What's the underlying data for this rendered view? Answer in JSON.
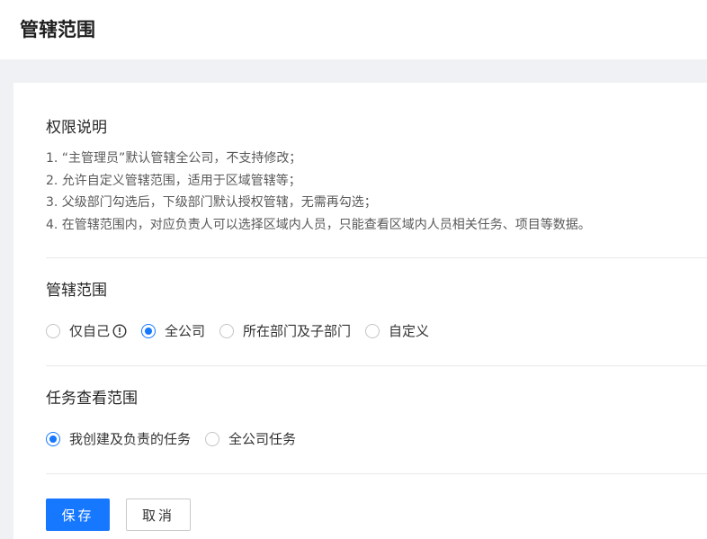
{
  "header": {
    "title": "管辖范围"
  },
  "permission": {
    "title": "权限说明",
    "rules": [
      "1. “主管理员”默认管辖全公司，不支持修改；",
      "2. 允许自定义管辖范围，适用于区域管辖等；",
      "3. 父级部门勾选后，下级部门默认授权管辖，无需再勾选；",
      "4. 在管辖范围内，对应负责人可以选择区域内人员，只能查看区域内人员相关任务、项目等数据。"
    ]
  },
  "scope": {
    "title": "管辖范围",
    "options": [
      {
        "label": "仅自己",
        "checked": false,
        "info_icon": "exclamation-circle-icon"
      },
      {
        "label": "全公司",
        "checked": true
      },
      {
        "label": "所在部门及子部门",
        "checked": false
      },
      {
        "label": "自定义",
        "checked": false
      }
    ]
  },
  "task_view": {
    "title": "任务查看范围",
    "options": [
      {
        "label": "我创建及负责的任务",
        "checked": true
      },
      {
        "label": "全公司任务",
        "checked": false
      }
    ]
  },
  "actions": {
    "save_label": "保存",
    "cancel_label": "取消"
  },
  "colors": {
    "primary": "#1677ff",
    "background": "#eff1f4",
    "divider": "#e8e8e8"
  }
}
